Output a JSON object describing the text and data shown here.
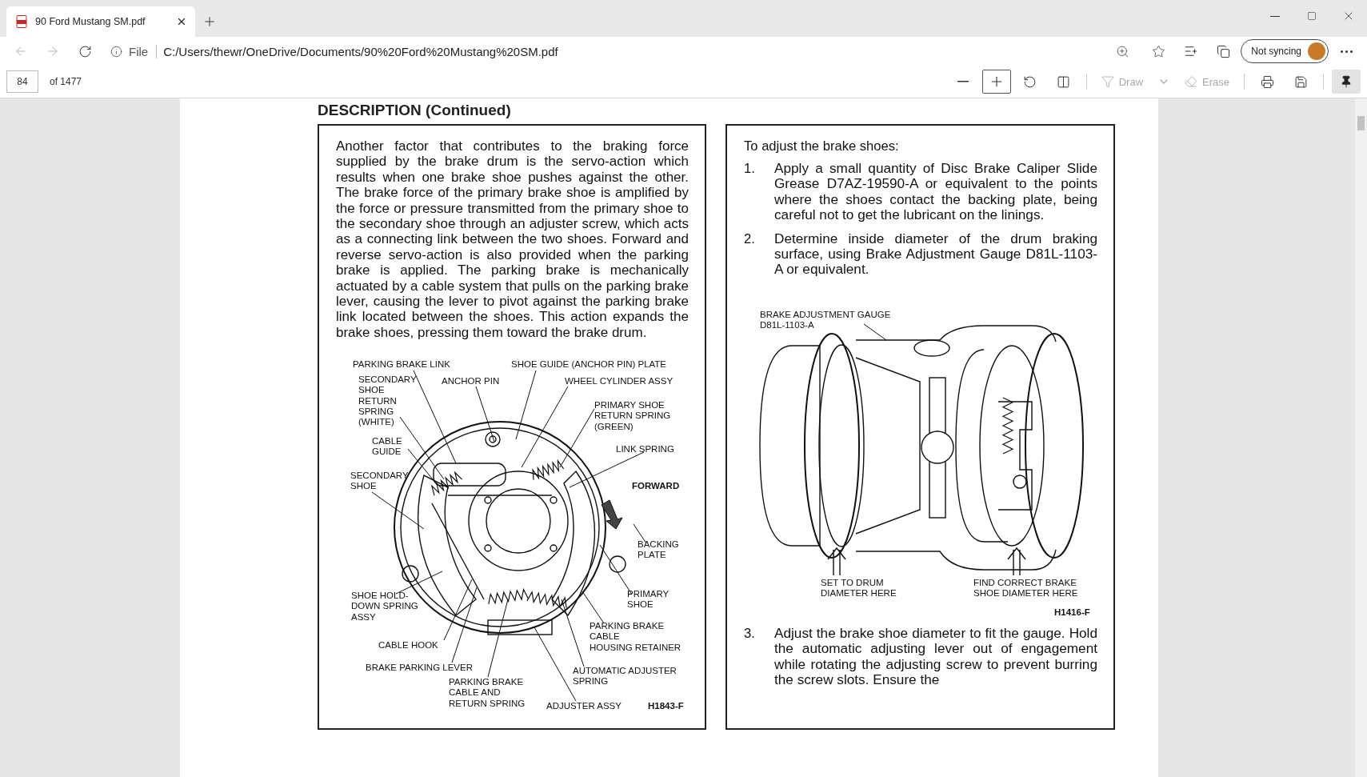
{
  "browser": {
    "tab": {
      "title": "90 Ford Mustang SM.pdf",
      "selected": true
    },
    "address": {
      "scheme": "File",
      "url": "C:/Users/thewr/OneDrive/Documents/90%20Ford%20Mustang%20SM.pdf"
    },
    "sync": {
      "label": "Not syncing"
    }
  },
  "pdf_toolbar": {
    "page": "84",
    "page_count": "of 1477",
    "tools": [
      {
        "kind": "draw",
        "label": "Draw",
        "disabled": true
      },
      {
        "kind": "erase",
        "label": "Erase",
        "disabled": true
      }
    ],
    "pinned": true
  },
  "document": {
    "heading": "DESCRIPTION (Continued)",
    "left": {
      "paragraph": "Another factor that contributes to the braking force supplied by the brake drum is the servo-action which results when one brake shoe pushes against the other. The brake force of the primary brake shoe is amplified by the force or pressure transmitted from the primary shoe to the secondary shoe through an adjuster screw, which acts as a connecting link between the two shoes. Forward and reverse servo-action is also provided when the parking brake is applied. The parking brake is mechanically actuated by a cable system that pulls on the parking brake lever, causing the lever to pivot against the parking brake link located between the shoes. This action expands the brake shoes, pressing them toward the brake drum.",
      "figure": {
        "labels": [
          {
            "text": "PARKING BRAKE LINK",
            "kind": "callout"
          },
          {
            "text": "SHOE GUIDE (ANCHOR PIN) PLATE",
            "kind": "callout"
          },
          {
            "text": "SECONDARY\nSHOE\nRETURN\nSPRING\n(WHITE)",
            "kind": "callout"
          },
          {
            "text": "ANCHOR PIN",
            "kind": "callout"
          },
          {
            "text": "WHEEL CYLINDER ASSY",
            "kind": "callout"
          },
          {
            "text": "PRIMARY SHOE\nRETURN SPRING\n(GREEN)",
            "kind": "callout"
          },
          {
            "text": "CABLE\nGUIDE",
            "kind": "callout"
          },
          {
            "text": "LINK SPRING",
            "kind": "callout"
          },
          {
            "text": "SECONDARY\nSHOE",
            "kind": "callout"
          },
          {
            "text": "FORWARD",
            "kind": "direction"
          },
          {
            "text": "BACKING\nPLATE",
            "kind": "callout"
          },
          {
            "text": "SHOE HOLD-\nDOWN SPRING\nASSY",
            "kind": "callout"
          },
          {
            "text": "PRIMARY\nSHOE",
            "kind": "callout"
          },
          {
            "text": "CABLE HOOK",
            "kind": "callout"
          },
          {
            "text": "PARKING BRAKE\nCABLE\nHOUSING RETAINER",
            "kind": "callout"
          },
          {
            "text": "BRAKE PARKING LEVER",
            "kind": "callout"
          },
          {
            "text": "AUTOMATIC ADJUSTER\nSPRING",
            "kind": "callout"
          },
          {
            "text": "PARKING BRAKE\nCABLE AND\nRETURN SPRING",
            "kind": "callout"
          },
          {
            "text": "ADJUSTER ASSY",
            "kind": "callout"
          },
          {
            "text": "H1843-F",
            "kind": "code"
          }
        ]
      }
    },
    "right": {
      "intro": "To adjust the brake shoes:",
      "steps": [
        {
          "number": "1.",
          "text": "Apply a small quantity of Disc Brake Caliper Slide Grease D7AZ-19590-A or equivalent to the points where the shoes contact the backing plate, being careful not to get the lubricant on the linings."
        },
        {
          "number": "2.",
          "text": "Determine inside diameter of the drum braking surface, using Brake Adjustment Gauge D81L-1103-A or equivalent."
        }
      ],
      "figure": {
        "labels": [
          {
            "text": "BRAKE ADJUSTMENT GAUGE\nD81L-1103-A",
            "kind": "callout"
          },
          {
            "text": "SET TO DRUM\nDIAMETER HERE",
            "kind": "callout"
          },
          {
            "text": "FIND CORRECT BRAKE\nSHOE DIAMETER HERE",
            "kind": "callout"
          },
          {
            "text": "H1416-F",
            "kind": "code"
          }
        ]
      },
      "more_steps": [
        {
          "number": "3.",
          "text": "Adjust the brake shoe diameter to fit the gauge. Hold the automatic adjusting lever out of engagement while rotating the adjusting screw to prevent burring the screw slots. Ensure the"
        }
      ]
    }
  }
}
